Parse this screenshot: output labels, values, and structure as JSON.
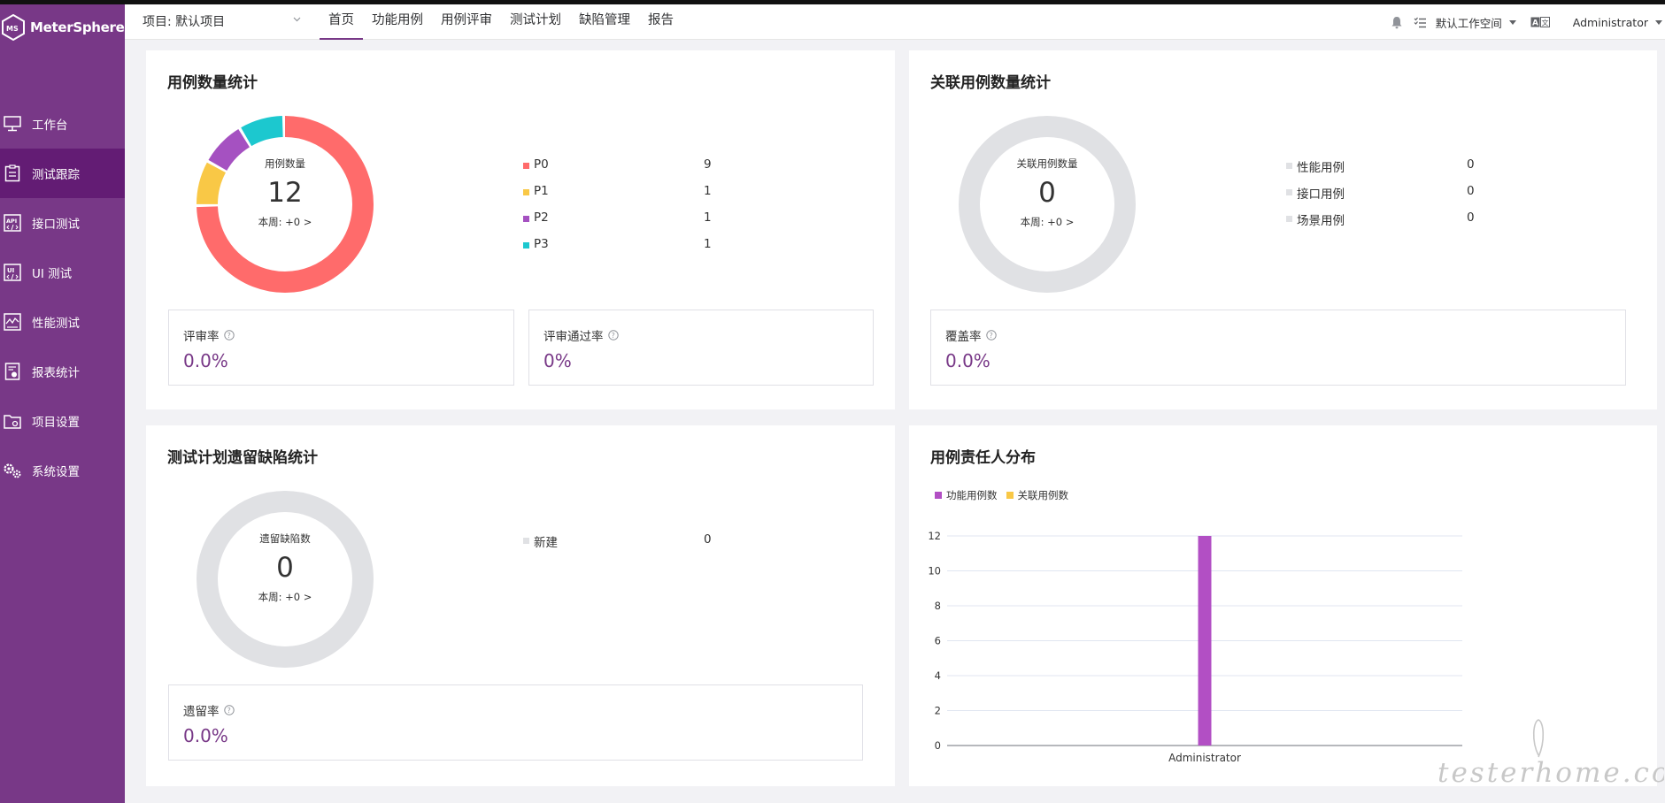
{
  "app": {
    "logo_text": "MeterSphere"
  },
  "sidebar": {
    "items": [
      {
        "label": "工作台",
        "icon": "monitor-icon"
      },
      {
        "label": "测试跟踪",
        "icon": "clipboard-icon",
        "active": true
      },
      {
        "label": "接口测试",
        "icon": "api-icon"
      },
      {
        "label": "UI 测试",
        "icon": "ui-icon"
      },
      {
        "label": "性能测试",
        "icon": "performance-icon"
      },
      {
        "label": "报表统计",
        "icon": "report-icon"
      },
      {
        "label": "项目设置",
        "icon": "folder-settings-icon"
      },
      {
        "label": "系统设置",
        "icon": "gears-icon"
      }
    ]
  },
  "header": {
    "project": "项目: 默认项目",
    "tabs": [
      "首页",
      "功能用例",
      "用例评审",
      "测试计划",
      "缺陷管理",
      "报告"
    ],
    "active_tab": "首页",
    "workspace": "默认工作空间",
    "user": "Administrator"
  },
  "colors": {
    "brand": "#783887",
    "p0": "#ff6b6b",
    "p1": "#f9c846",
    "p2": "#a551c1",
    "p3": "#1cc8cf",
    "empty": "#e0e1e4",
    "bar_func": "#b24fc4",
    "bar_rel": "#f9c846"
  },
  "case_stats": {
    "title": "用例数量统计",
    "center_label": "用例数量",
    "total": "12",
    "week": "本周: +0 >",
    "legend": [
      {
        "name": "P0",
        "value": "9"
      },
      {
        "name": "P1",
        "value": "1"
      },
      {
        "name": "P2",
        "value": "1"
      },
      {
        "name": "P3",
        "value": "1"
      }
    ],
    "metrics": [
      {
        "label": "评审率",
        "value": "0.0%"
      },
      {
        "label": "评审通过率",
        "value": "0%"
      }
    ]
  },
  "related_stats": {
    "title": "关联用例数量统计",
    "center_label": "关联用例数量",
    "total": "0",
    "week": "本周: +0 >",
    "legend": [
      {
        "name": "性能用例",
        "value": "0"
      },
      {
        "name": "接口用例",
        "value": "0"
      },
      {
        "name": "场景用例",
        "value": "0"
      }
    ],
    "metrics": [
      {
        "label": "覆盖率",
        "value": "0.0%"
      }
    ]
  },
  "defect_stats": {
    "title": "测试计划遗留缺陷统计",
    "center_label": "遗留缺陷数",
    "total": "0",
    "week": "本周: +0 >",
    "legend": [
      {
        "name": "新建",
        "value": "0"
      }
    ],
    "metrics": [
      {
        "label": "遗留率",
        "value": "0.0%"
      }
    ]
  },
  "owner_dist": {
    "title": "用例责任人分布",
    "legend": [
      "功能用例数",
      "关联用例数"
    ]
  },
  "chart_data": {
    "type": "bar",
    "categories": [
      "Administrator"
    ],
    "series": [
      {
        "name": "功能用例数",
        "values": [
          12
        ]
      },
      {
        "name": "关联用例数",
        "values": [
          0
        ]
      }
    ],
    "yticks": [
      "0",
      "2",
      "4",
      "6",
      "8",
      "10",
      "12"
    ],
    "ylim": [
      0,
      12
    ],
    "legend_position": "top-left",
    "grid": true
  },
  "watermark": "testerhome.com"
}
